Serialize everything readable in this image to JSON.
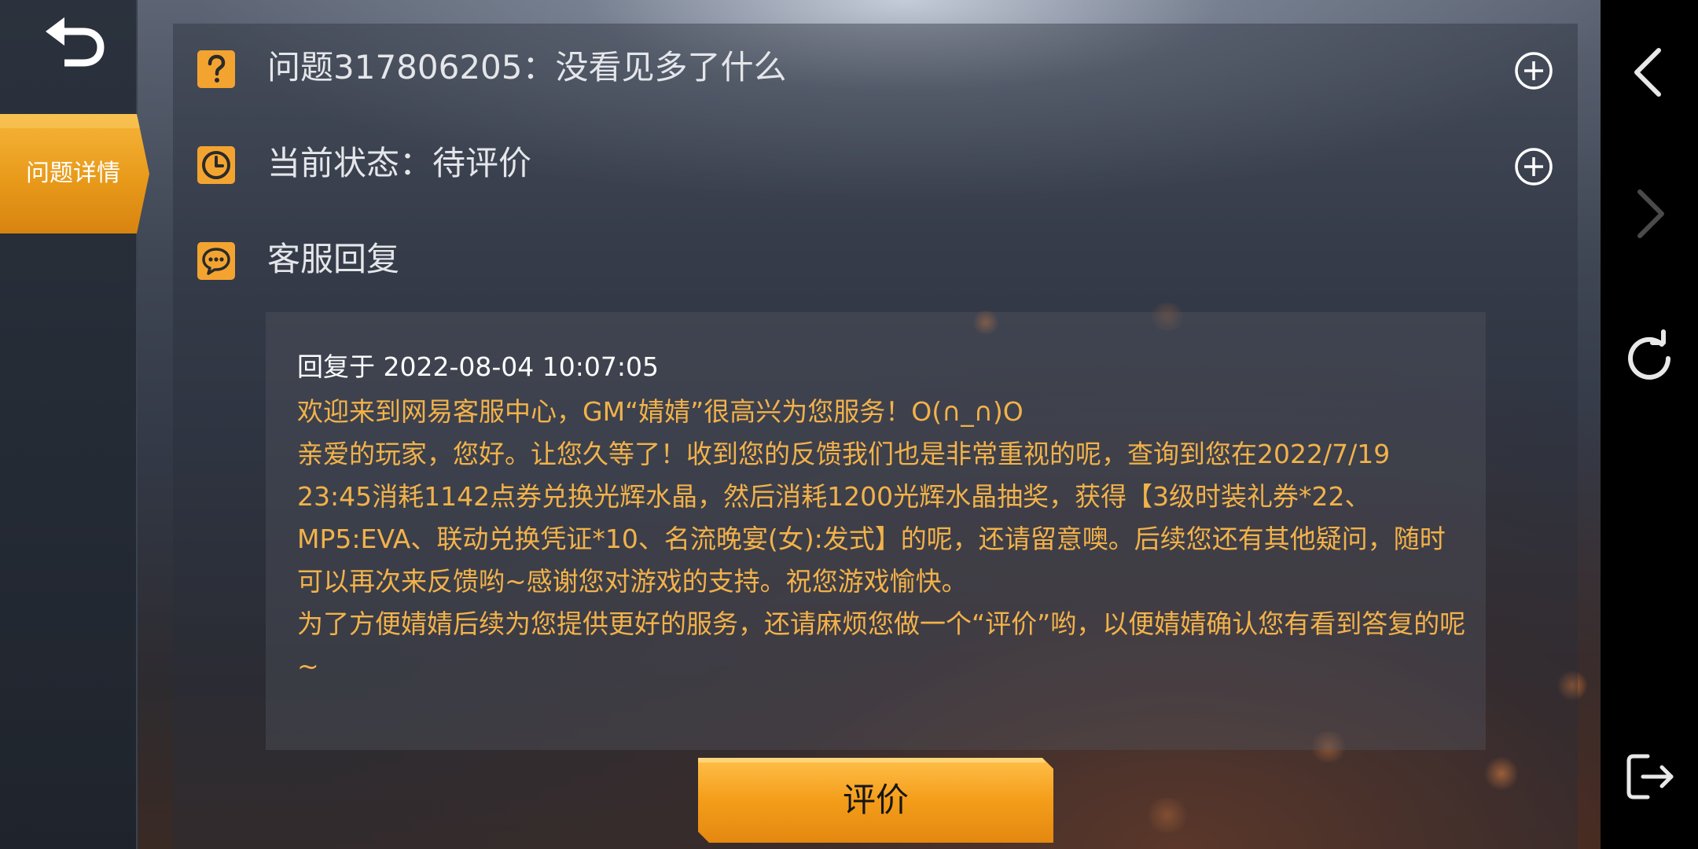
{
  "colors": {
    "accent_orange": "#f3a430",
    "reply_text": "#f2b24a",
    "row_text": "#e4e6ea",
    "nav_background": "#000000"
  },
  "left_rail": {
    "back_icon": "undo-arrow-icon",
    "active_tab_label": "问题详情"
  },
  "issue": {
    "title_row": {
      "icon": "question-mark-icon",
      "text": "问题317806205：没看见多了什么",
      "expand_icon": "plus-circle-icon"
    },
    "status_row": {
      "icon": "clock-icon",
      "text": "当前状态：待评价",
      "expand_icon": "plus-circle-icon"
    },
    "reply_row": {
      "icon": "chat-bubble-icon",
      "text": "客服回复"
    }
  },
  "reply": {
    "timestamp": "回复于 2022-08-04 10:07:05",
    "paragraphs": [
      "欢迎来到网易客服中心，GM“婧婧”很高兴为您服务！O(∩_∩)O",
      "亲爱的玩家，您好。让您久等了！收到您的反馈我们也是非常重视的呢，查询到您在2022/7/19 23:45消耗1142点券兑换光辉水晶，然后消耗1200光辉水晶抽奖，获得【3级时装礼券*22、MP5:EVA、联动兑换凭证*10、名流晚宴(女):发式】的呢，还请留意噢。后续您还有其他疑问，随时可以再次来反馈哟~感谢您对游戏的支持。祝您游戏愉快。",
      "为了方便婧婧后续为您提供更好的服务，还请麻烦您做一个“评价”哟，以便婧婧确认您有看到答复的呢~"
    ]
  },
  "rate_button": {
    "label": "评价"
  },
  "system_nav": {
    "items": [
      {
        "icon": "chevron-left-icon",
        "enabled": true
      },
      {
        "icon": "chevron-right-icon",
        "enabled": false
      },
      {
        "icon": "refresh-icon",
        "enabled": true
      },
      {
        "icon": "exit-icon",
        "enabled": true
      }
    ]
  }
}
